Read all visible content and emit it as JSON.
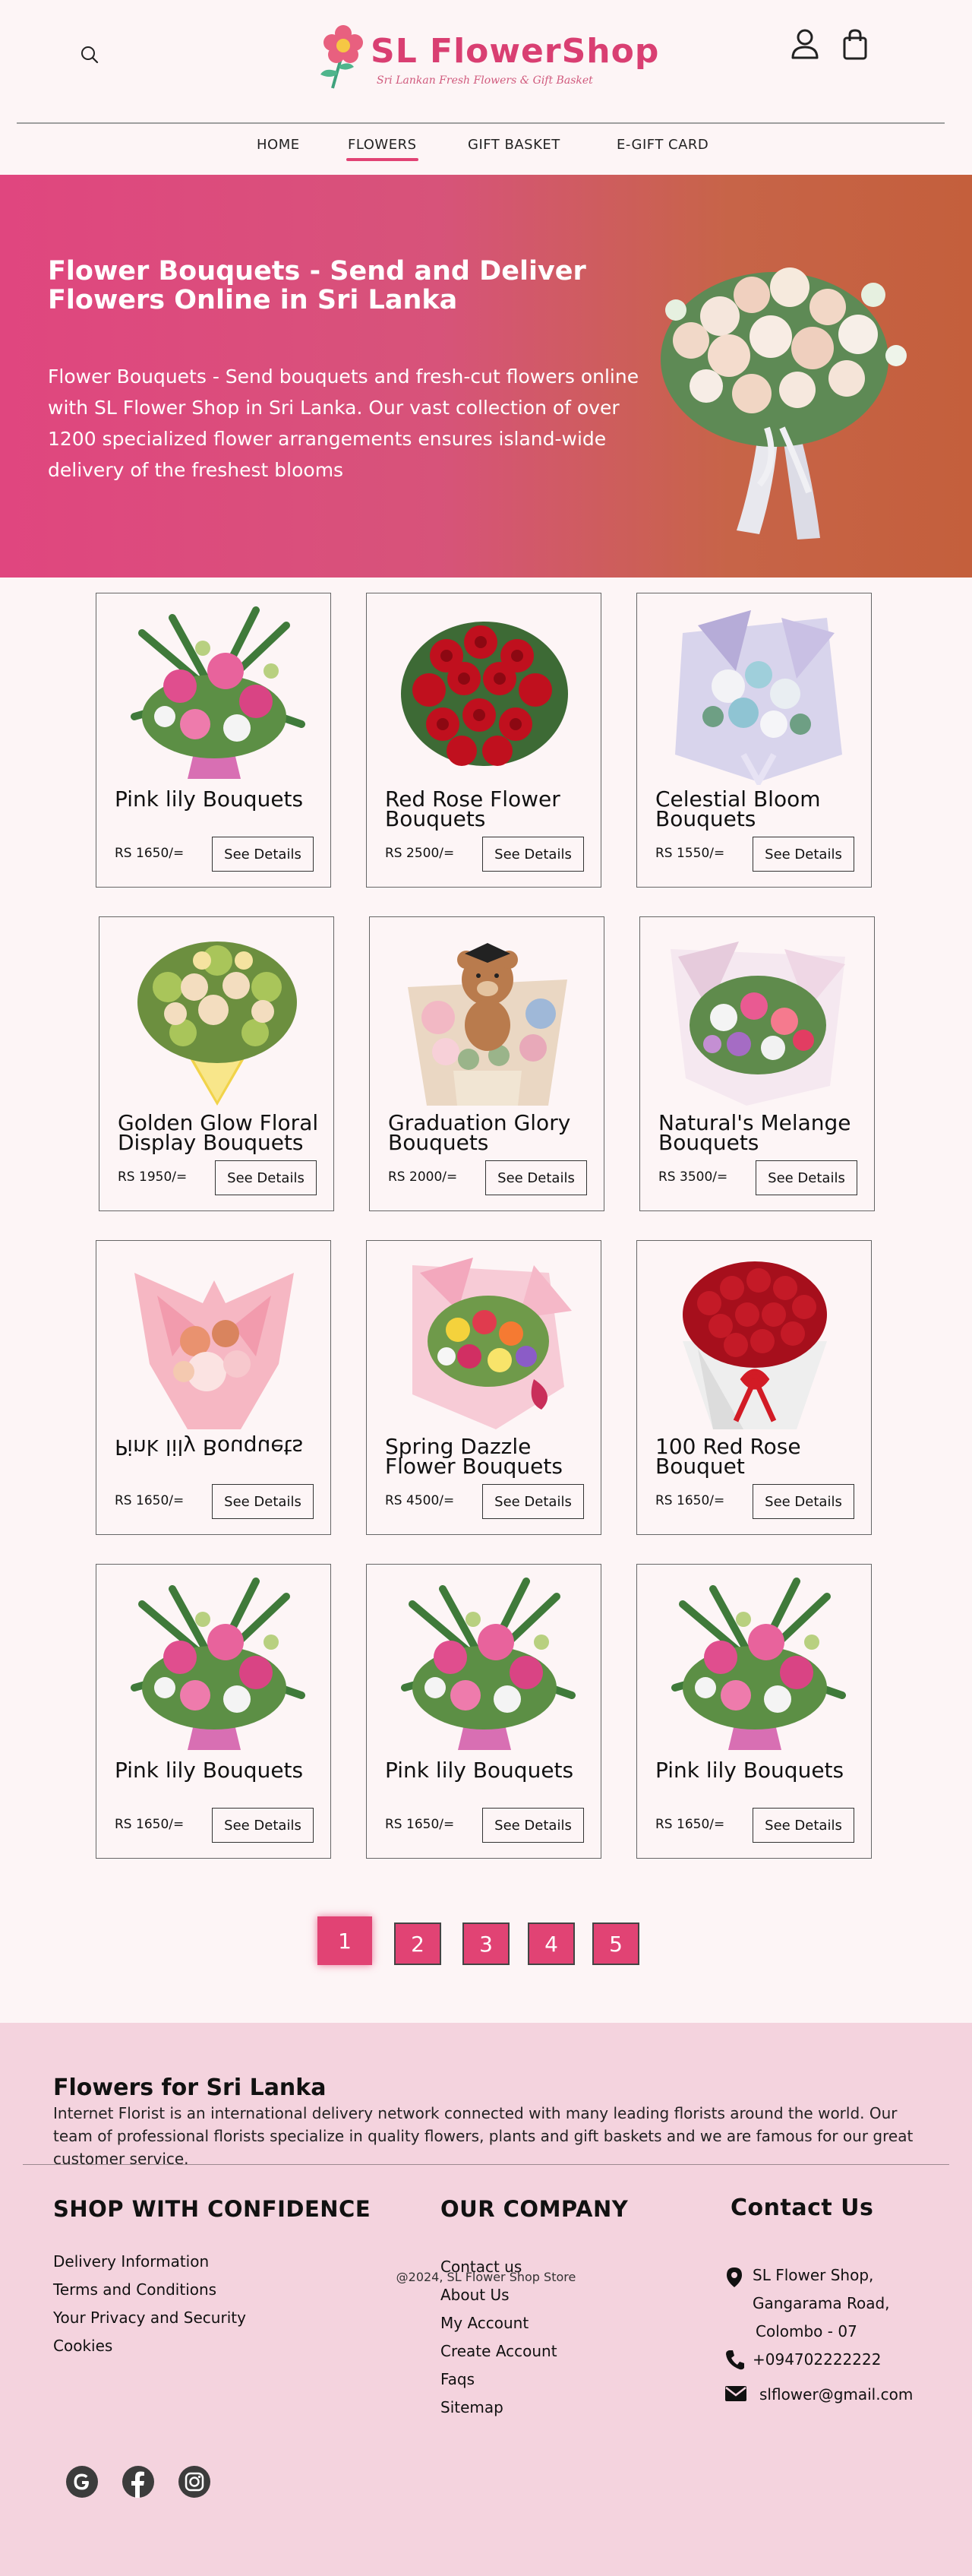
{
  "brand": {
    "name": "SL  FlowerShop",
    "tagline": "Sri Lankan Fresh Flowers & Gift Basket"
  },
  "nav": {
    "items": [
      {
        "label": "HOME"
      },
      {
        "label": "FLOWERS",
        "active": true
      },
      {
        "label": "GIFT BASKET"
      },
      {
        "label": "E-GIFT CARD"
      }
    ]
  },
  "hero": {
    "title": "Flower Bouquets - Send and Deliver Flowers Online in Sri Lanka",
    "text": "Flower Bouquets - Send bouquets and fresh-cut flowers online with SL Flower Shop in Sri Lanka. Our vast collection of over 1200 specialized flower arrangements ensures island-wide delivery of the freshest blooms"
  },
  "products": [
    {
      "name": "Pink lily Bouquets",
      "price": "RS 1650/=",
      "button": "See Details",
      "image": "pink-lily-bouquet"
    },
    {
      "name": "Red Rose Flower Bouquets",
      "price": "RS 2500/=",
      "button": "See Details",
      "image": "red-rose-bouquet"
    },
    {
      "name": "Celestial Bloom Bouquets",
      "price": "RS 1550/=",
      "button": "See Details",
      "image": "blue-white-bouquet"
    },
    {
      "name": "Golden Glow Floral Display Bouquets",
      "price": "RS 1950/=",
      "button": "See Details",
      "image": "yellow-bouquet"
    },
    {
      "name": "Graduation Glory Bouquets",
      "price": "RS 2000/=",
      "button": "See Details",
      "image": "teddy-bear-bouquet"
    },
    {
      "name": "Natural's  Melange Bouquets",
      "price": "RS 3500/=",
      "button": "See Details",
      "image": "mixed-bouquet"
    },
    {
      "name": "Pink lily Bouquets",
      "price": "RS 1650/=",
      "button": "See Details",
      "image": "pink-rose-bouquet",
      "flipped": true
    },
    {
      "name": "Spring Dazzle Flower Bouquets",
      "price": "RS 4500/=",
      "button": "See Details",
      "image": "colorful-bouquet"
    },
    {
      "name": "100 Red Rose Bouquet",
      "price": "RS 1650/=",
      "button": "See Details",
      "image": "hundred-rose-bouquet"
    },
    {
      "name": "Pink lily Bouquets",
      "price": "RS 1650/=",
      "button": "See Details",
      "image": "pink-lily-bouquet"
    },
    {
      "name": "Pink lily Bouquets",
      "price": "RS 1650/=",
      "button": "See Details",
      "image": "pink-lily-bouquet"
    },
    {
      "name": "Pink lily Bouquets",
      "price": "RS 1650/=",
      "button": "See Details",
      "image": "pink-lily-bouquet"
    }
  ],
  "pagination": {
    "pages": [
      "1",
      "2",
      "3",
      "4",
      "5"
    ],
    "current": "1"
  },
  "footer": {
    "title": "Flowers for Sri Lanka",
    "about": "Internet Florist is an international delivery network connected with many leading florists around the world. Our team of professional florists specialize in quality flowers, plants and gift baskets and we are famous for our great customer service.",
    "shop": {
      "title": "SHOP WITH CONFIDENCE",
      "links": [
        "Delivery Information",
        "Terms and Conditions",
        "Your Privacy and Security",
        "Cookies"
      ]
    },
    "company": {
      "title": "OUR COMPANY",
      "links": [
        "Contact us",
        "About Us",
        "My Account",
        "Create Account",
        "Faqs",
        "Sitemap"
      ]
    },
    "contact": {
      "title": "Contact Us",
      "address": [
        "SL Flower Shop,",
        "Gangarama Road,",
        "Colombo - 07"
      ],
      "phone": "+094702222222",
      "email": "slflower@gmail.com"
    },
    "social": [
      "google-icon",
      "facebook-icon",
      "instagram-icon"
    ],
    "copyright": "@2024, SL Flower Shop Store"
  },
  "colors": {
    "accent": "#e14374",
    "background": "#fdf5f6",
    "footer": "#f4d3de",
    "hero_gradient_start": "#e0467f",
    "hero_gradient_end": "#c45f3c"
  }
}
